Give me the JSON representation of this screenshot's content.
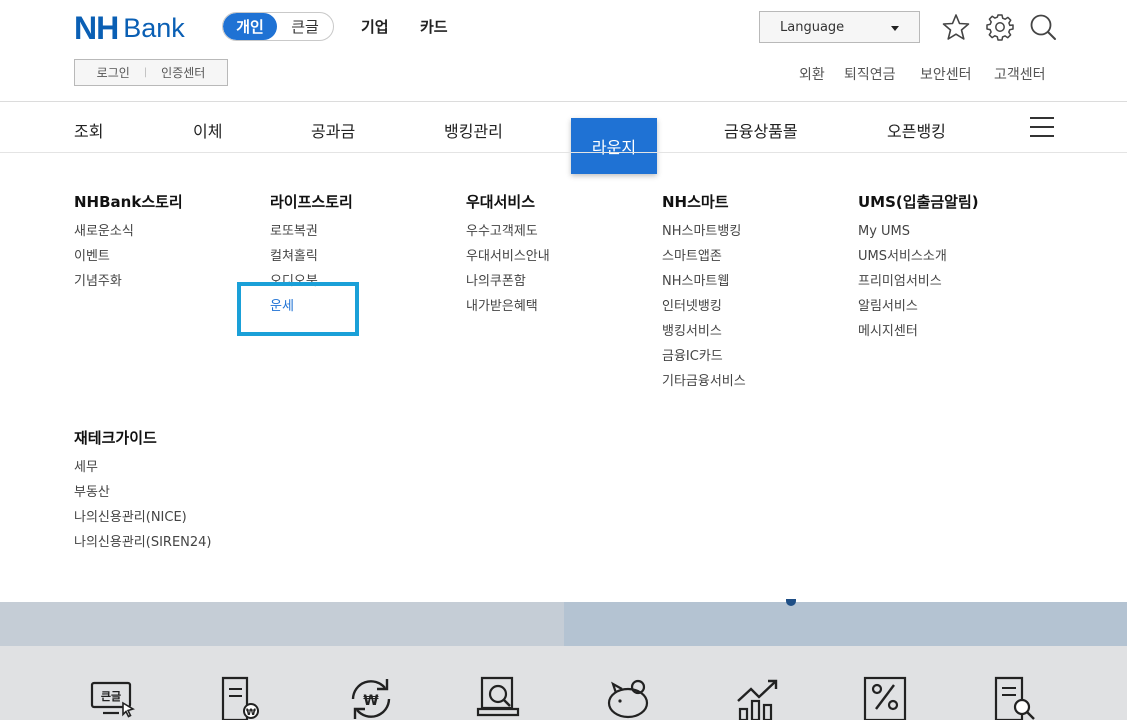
{
  "brand": {
    "nh": "NH",
    "bank": "Bank",
    "color": "#0a5fb4"
  },
  "segment": {
    "active": "개인",
    "inactive": "큰글"
  },
  "top_nav": [
    "기업",
    "카드"
  ],
  "login_box": {
    "login": "로그인",
    "cert": "인증센터",
    "sep": "|"
  },
  "language": {
    "value": "Language"
  },
  "header_icons": [
    "star-icon",
    "gear-icon",
    "search-icon"
  ],
  "utility_links": [
    "외환",
    "퇴직연금",
    "보안센터",
    "고객센터"
  ],
  "gnb": {
    "items": [
      "조회",
      "이체",
      "공과금",
      "뱅킹관리",
      "라운지",
      "금융상품몰",
      "오픈뱅킹"
    ],
    "active": "라운지",
    "active_color": "#1f72d4"
  },
  "mega_menu": [
    {
      "title": "NHBank스토리",
      "items": [
        "새로운소식",
        "이벤트",
        "기념주화"
      ]
    },
    {
      "title": "라이프스토리",
      "items": [
        "로또복권",
        "컬쳐홀릭",
        "오디오북",
        "운세"
      ]
    },
    {
      "title": "우대서비스",
      "items": [
        "우수고객제도",
        "우대서비스안내",
        "나의쿠폰함",
        "내가받은혜택"
      ]
    },
    {
      "title": "NH스마트",
      "items": [
        "NH스마트뱅킹",
        "스마트앱존",
        "NH스마트웹",
        "인터넷뱅킹",
        "뱅킹서비스",
        "금융IC카드",
        "기타금융서비스"
      ]
    },
    {
      "title": "UMS(입출금알림)",
      "items": [
        "My UMS",
        "UMS서비스소개",
        "프리미엄서비스",
        "알림서비스",
        "메시지센터"
      ]
    },
    {
      "title": "재테크가이드",
      "items": [
        "세무",
        "부동산",
        "나의신용관리(NICE)",
        "나의신용관리(SIREN24)"
      ]
    }
  ],
  "highlight": {
    "item": "운세",
    "color": "#1aa0d8"
  },
  "quick_icons": [
    "big-text-monitor-icon",
    "document-won-icon",
    "exchange-won-icon",
    "search-document-icon",
    "piggy-bank-icon",
    "growth-chart-icon",
    "percent-document-icon",
    "document-search-icon"
  ]
}
